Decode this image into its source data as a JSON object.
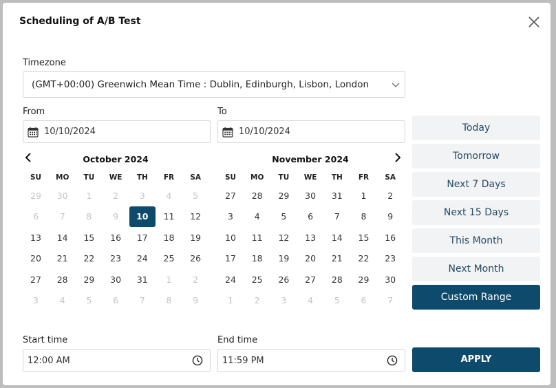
{
  "dialog": {
    "title": "Scheduling of A/B Test"
  },
  "timezone": {
    "label": "Timezone",
    "value": "(GMT+00:00) Greenwich Mean Time : Dublin, Edinburgh, Lisbon, London"
  },
  "from": {
    "label": "From",
    "value": "10/10/2024"
  },
  "to": {
    "label": "To",
    "value": "10/10/2024"
  },
  "calendar": {
    "weekdays": [
      "SU",
      "MO",
      "TU",
      "WE",
      "TH",
      "FR",
      "SA"
    ],
    "months": [
      {
        "title": "October 2024",
        "weeks": [
          [
            {
              "d": "29",
              "m": true
            },
            {
              "d": "30",
              "m": true
            },
            {
              "d": "1",
              "m": true
            },
            {
              "d": "2",
              "m": true
            },
            {
              "d": "3",
              "m": true
            },
            {
              "d": "4",
              "m": true
            },
            {
              "d": "5",
              "m": true
            }
          ],
          [
            {
              "d": "6",
              "m": true
            },
            {
              "d": "7",
              "m": true
            },
            {
              "d": "8",
              "m": true
            },
            {
              "d": "9",
              "m": true
            },
            {
              "d": "10",
              "s": true
            },
            {
              "d": "11"
            },
            {
              "d": "12"
            }
          ],
          [
            {
              "d": "13"
            },
            {
              "d": "14"
            },
            {
              "d": "15"
            },
            {
              "d": "16"
            },
            {
              "d": "17"
            },
            {
              "d": "18"
            },
            {
              "d": "19"
            }
          ],
          [
            {
              "d": "20"
            },
            {
              "d": "21"
            },
            {
              "d": "22"
            },
            {
              "d": "23"
            },
            {
              "d": "24"
            },
            {
              "d": "25"
            },
            {
              "d": "26"
            }
          ],
          [
            {
              "d": "27"
            },
            {
              "d": "28"
            },
            {
              "d": "29"
            },
            {
              "d": "30"
            },
            {
              "d": "31"
            },
            {
              "d": "1",
              "m": true
            },
            {
              "d": "2",
              "m": true
            }
          ],
          [
            {
              "d": "3",
              "m": true
            },
            {
              "d": "4",
              "m": true
            },
            {
              "d": "5",
              "m": true
            },
            {
              "d": "6",
              "m": true
            },
            {
              "d": "7",
              "m": true
            },
            {
              "d": "8",
              "m": true
            },
            {
              "d": "9",
              "m": true
            }
          ]
        ]
      },
      {
        "title": "November 2024",
        "weeks": [
          [
            {
              "d": "27"
            },
            {
              "d": "28"
            },
            {
              "d": "29"
            },
            {
              "d": "30"
            },
            {
              "d": "31"
            },
            {
              "d": "1"
            },
            {
              "d": "2"
            }
          ],
          [
            {
              "d": "3"
            },
            {
              "d": "4"
            },
            {
              "d": "5"
            },
            {
              "d": "6"
            },
            {
              "d": "7"
            },
            {
              "d": "8"
            },
            {
              "d": "9"
            }
          ],
          [
            {
              "d": "10"
            },
            {
              "d": "11"
            },
            {
              "d": "12"
            },
            {
              "d": "13"
            },
            {
              "d": "14"
            },
            {
              "d": "15"
            },
            {
              "d": "16"
            }
          ],
          [
            {
              "d": "17"
            },
            {
              "d": "18"
            },
            {
              "d": "19"
            },
            {
              "d": "20"
            },
            {
              "d": "21"
            },
            {
              "d": "22"
            },
            {
              "d": "23"
            }
          ],
          [
            {
              "d": "24"
            },
            {
              "d": "25"
            },
            {
              "d": "26"
            },
            {
              "d": "27"
            },
            {
              "d": "28"
            },
            {
              "d": "29"
            },
            {
              "d": "30"
            }
          ],
          [
            {
              "d": "1",
              "m": true
            },
            {
              "d": "2",
              "m": true
            },
            {
              "d": "3",
              "m": true
            },
            {
              "d": "4",
              "m": true
            },
            {
              "d": "5",
              "m": true
            },
            {
              "d": "6",
              "m": true
            },
            {
              "d": "7",
              "m": true
            }
          ]
        ]
      }
    ]
  },
  "ranges": [
    {
      "label": "Today"
    },
    {
      "label": "Tomorrow"
    },
    {
      "label": "Next 7 Days"
    },
    {
      "label": "Next 15 Days"
    },
    {
      "label": "This Month"
    },
    {
      "label": "Next Month"
    },
    {
      "label": "Custom Range",
      "active": true
    }
  ],
  "start_time": {
    "label": "Start time",
    "value": "12:00  AM"
  },
  "end_time": {
    "label": "End time",
    "value": "11:59  PM"
  },
  "apply_label": "APPLY",
  "colors": {
    "accent": "#0e4a6b",
    "range_bg": "#f1f3f5",
    "range_text": "#254a62",
    "muted_day": "#c4c4c4"
  },
  "icons": {
    "close": "close-icon",
    "dropdown": "chevron-down-icon",
    "calendar": "calendar-icon",
    "prev": "chevron-left-icon",
    "next": "chevron-right-icon",
    "clock": "clock-icon"
  }
}
